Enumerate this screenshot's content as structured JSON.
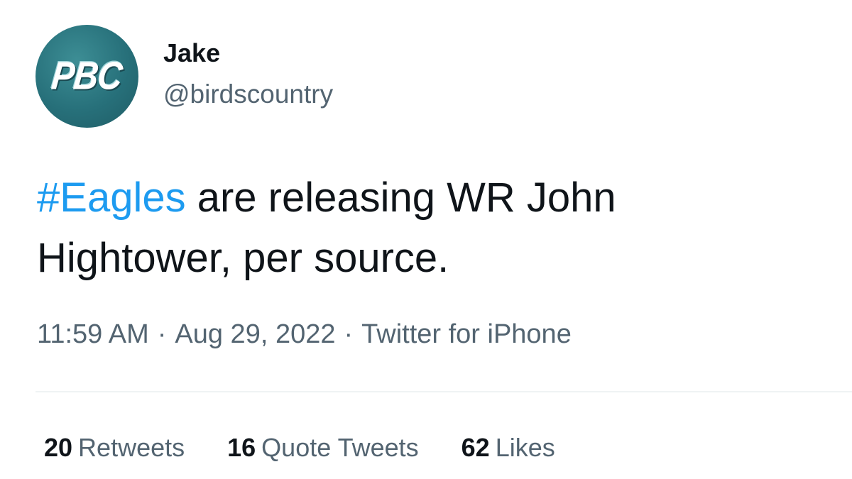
{
  "author": {
    "avatar_text": "PBC",
    "display_name": "Jake",
    "handle": "@birdscountry"
  },
  "tweet": {
    "hashtag": "#Eagles",
    "text": " are releasing WR John Hightower, per source."
  },
  "meta": {
    "time": "11:59 AM",
    "date": "Aug 29, 2022",
    "source": "Twitter for iPhone",
    "separator": "·"
  },
  "stats": {
    "retweets_count": "20",
    "retweets_label": "Retweets",
    "quotes_count": "16",
    "quotes_label": "Quote Tweets",
    "likes_count": "62",
    "likes_label": "Likes"
  },
  "colors": {
    "hashtag": "#1d9bf0",
    "secondary_text": "#536471",
    "avatar_bg": "#27707a"
  }
}
